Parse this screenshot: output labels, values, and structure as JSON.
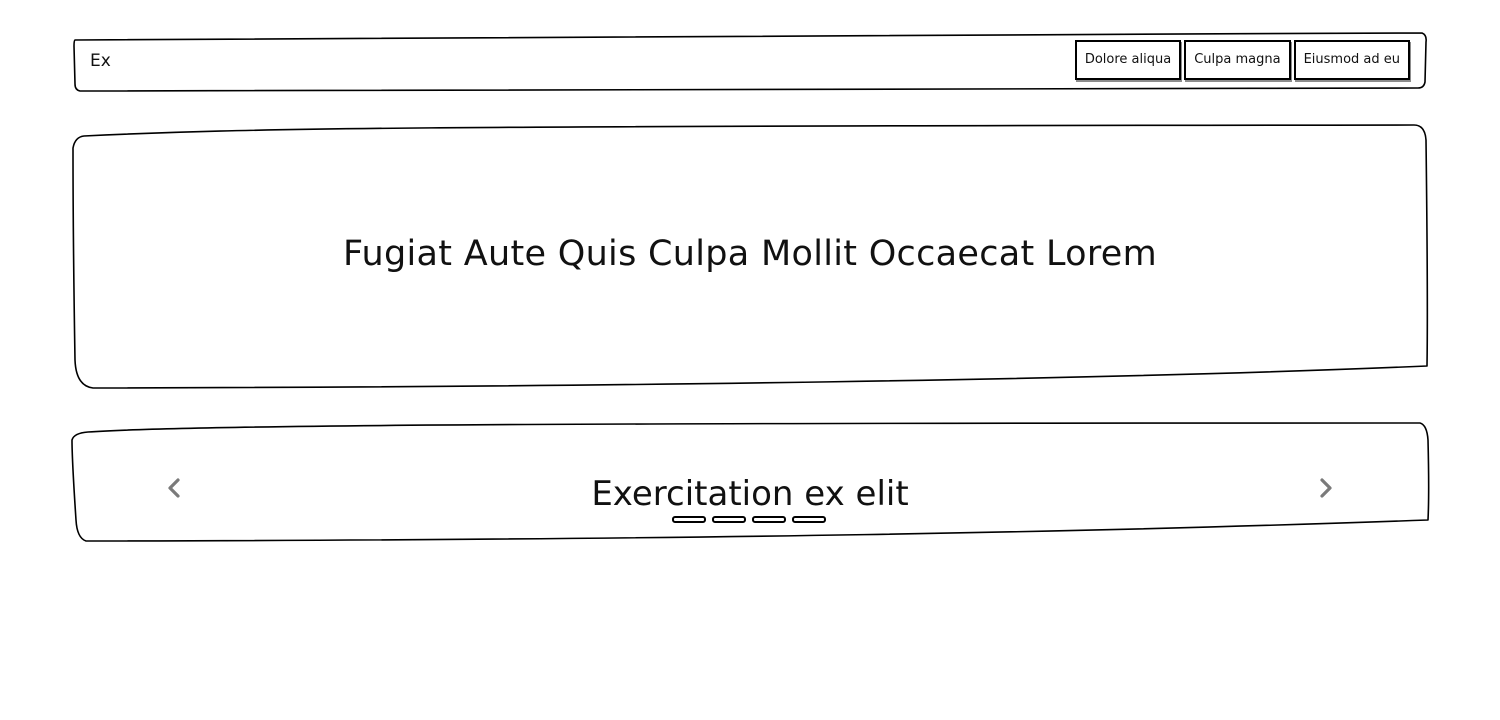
{
  "navbar": {
    "brand": "Ex",
    "buttons": [
      {
        "label": "Dolore aliqua"
      },
      {
        "label": "Culpa magna"
      },
      {
        "label": "Eiusmod ad eu"
      }
    ]
  },
  "hero": {
    "title": "Fugiat Aute Quis Culpa Mollit Occaecat Lorem"
  },
  "carousel": {
    "slide_title": "Exercitation ex elit",
    "prev_icon": "chevron-left-icon",
    "next_icon": "chevron-right-icon",
    "slide_count": 4,
    "arrow_color": "#7a7a7a"
  }
}
